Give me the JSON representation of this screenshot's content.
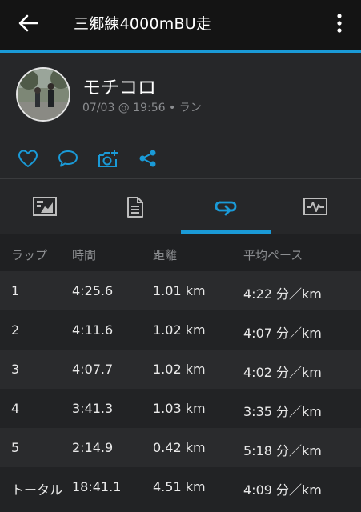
{
  "app_bar": {
    "title": "三郷練4000mBU走"
  },
  "activity": {
    "user_name": "モチコロ",
    "meta": "07/03 @ 19:56 • ラン"
  },
  "actions": [
    "like-icon",
    "comment-icon",
    "add-photo-icon",
    "share-icon"
  ],
  "tabs": [
    {
      "name": "overview-icon",
      "selected": false
    },
    {
      "name": "details-icon",
      "selected": false
    },
    {
      "name": "laps-icon",
      "selected": true
    },
    {
      "name": "chart-icon",
      "selected": false
    }
  ],
  "colors": {
    "accent": "#1a9ad7",
    "background": "#222325",
    "appbar": "#141414"
  },
  "laps_table": {
    "headers": [
      "ラップ",
      "時間",
      "距離",
      "平均ペース"
    ],
    "rows": [
      [
        "1",
        "4:25.6",
        "1.01 km",
        "4:22 分／km"
      ],
      [
        "2",
        "4:11.6",
        "1.02 km",
        "4:07 分／km"
      ],
      [
        "3",
        "4:07.7",
        "1.02 km",
        "4:02 分／km"
      ],
      [
        "4",
        "3:41.3",
        "1.03 km",
        "3:35 分／km"
      ],
      [
        "5",
        "2:14.9",
        "0.42 km",
        "5:18 分／km"
      ],
      [
        "トータル",
        "18:41.1",
        "4.51 km",
        "4:09 分／km"
      ]
    ]
  }
}
